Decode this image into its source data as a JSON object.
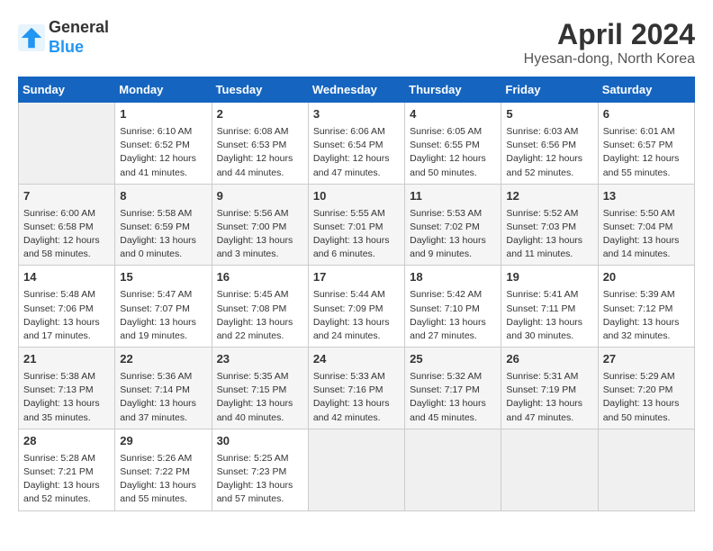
{
  "logo": {
    "line1": "General",
    "line2": "Blue"
  },
  "title": "April 2024",
  "subtitle": "Hyesan-dong, North Korea",
  "weekdays": [
    "Sunday",
    "Monday",
    "Tuesday",
    "Wednesday",
    "Thursday",
    "Friday",
    "Saturday"
  ],
  "weeks": [
    [
      {
        "day": "",
        "info": ""
      },
      {
        "day": "1",
        "info": "Sunrise: 6:10 AM\nSunset: 6:52 PM\nDaylight: 12 hours\nand 41 minutes."
      },
      {
        "day": "2",
        "info": "Sunrise: 6:08 AM\nSunset: 6:53 PM\nDaylight: 12 hours\nand 44 minutes."
      },
      {
        "day": "3",
        "info": "Sunrise: 6:06 AM\nSunset: 6:54 PM\nDaylight: 12 hours\nand 47 minutes."
      },
      {
        "day": "4",
        "info": "Sunrise: 6:05 AM\nSunset: 6:55 PM\nDaylight: 12 hours\nand 50 minutes."
      },
      {
        "day": "5",
        "info": "Sunrise: 6:03 AM\nSunset: 6:56 PM\nDaylight: 12 hours\nand 52 minutes."
      },
      {
        "day": "6",
        "info": "Sunrise: 6:01 AM\nSunset: 6:57 PM\nDaylight: 12 hours\nand 55 minutes."
      }
    ],
    [
      {
        "day": "7",
        "info": "Sunrise: 6:00 AM\nSunset: 6:58 PM\nDaylight: 12 hours\nand 58 minutes."
      },
      {
        "day": "8",
        "info": "Sunrise: 5:58 AM\nSunset: 6:59 PM\nDaylight: 13 hours\nand 0 minutes."
      },
      {
        "day": "9",
        "info": "Sunrise: 5:56 AM\nSunset: 7:00 PM\nDaylight: 13 hours\nand 3 minutes."
      },
      {
        "day": "10",
        "info": "Sunrise: 5:55 AM\nSunset: 7:01 PM\nDaylight: 13 hours\nand 6 minutes."
      },
      {
        "day": "11",
        "info": "Sunrise: 5:53 AM\nSunset: 7:02 PM\nDaylight: 13 hours\nand 9 minutes."
      },
      {
        "day": "12",
        "info": "Sunrise: 5:52 AM\nSunset: 7:03 PM\nDaylight: 13 hours\nand 11 minutes."
      },
      {
        "day": "13",
        "info": "Sunrise: 5:50 AM\nSunset: 7:04 PM\nDaylight: 13 hours\nand 14 minutes."
      }
    ],
    [
      {
        "day": "14",
        "info": "Sunrise: 5:48 AM\nSunset: 7:06 PM\nDaylight: 13 hours\nand 17 minutes."
      },
      {
        "day": "15",
        "info": "Sunrise: 5:47 AM\nSunset: 7:07 PM\nDaylight: 13 hours\nand 19 minutes."
      },
      {
        "day": "16",
        "info": "Sunrise: 5:45 AM\nSunset: 7:08 PM\nDaylight: 13 hours\nand 22 minutes."
      },
      {
        "day": "17",
        "info": "Sunrise: 5:44 AM\nSunset: 7:09 PM\nDaylight: 13 hours\nand 24 minutes."
      },
      {
        "day": "18",
        "info": "Sunrise: 5:42 AM\nSunset: 7:10 PM\nDaylight: 13 hours\nand 27 minutes."
      },
      {
        "day": "19",
        "info": "Sunrise: 5:41 AM\nSunset: 7:11 PM\nDaylight: 13 hours\nand 30 minutes."
      },
      {
        "day": "20",
        "info": "Sunrise: 5:39 AM\nSunset: 7:12 PM\nDaylight: 13 hours\nand 32 minutes."
      }
    ],
    [
      {
        "day": "21",
        "info": "Sunrise: 5:38 AM\nSunset: 7:13 PM\nDaylight: 13 hours\nand 35 minutes."
      },
      {
        "day": "22",
        "info": "Sunrise: 5:36 AM\nSunset: 7:14 PM\nDaylight: 13 hours\nand 37 minutes."
      },
      {
        "day": "23",
        "info": "Sunrise: 5:35 AM\nSunset: 7:15 PM\nDaylight: 13 hours\nand 40 minutes."
      },
      {
        "day": "24",
        "info": "Sunrise: 5:33 AM\nSunset: 7:16 PM\nDaylight: 13 hours\nand 42 minutes."
      },
      {
        "day": "25",
        "info": "Sunrise: 5:32 AM\nSunset: 7:17 PM\nDaylight: 13 hours\nand 45 minutes."
      },
      {
        "day": "26",
        "info": "Sunrise: 5:31 AM\nSunset: 7:19 PM\nDaylight: 13 hours\nand 47 minutes."
      },
      {
        "day": "27",
        "info": "Sunrise: 5:29 AM\nSunset: 7:20 PM\nDaylight: 13 hours\nand 50 minutes."
      }
    ],
    [
      {
        "day": "28",
        "info": "Sunrise: 5:28 AM\nSunset: 7:21 PM\nDaylight: 13 hours\nand 52 minutes."
      },
      {
        "day": "29",
        "info": "Sunrise: 5:26 AM\nSunset: 7:22 PM\nDaylight: 13 hours\nand 55 minutes."
      },
      {
        "day": "30",
        "info": "Sunrise: 5:25 AM\nSunset: 7:23 PM\nDaylight: 13 hours\nand 57 minutes."
      },
      {
        "day": "",
        "info": ""
      },
      {
        "day": "",
        "info": ""
      },
      {
        "day": "",
        "info": ""
      },
      {
        "day": "",
        "info": ""
      }
    ]
  ]
}
